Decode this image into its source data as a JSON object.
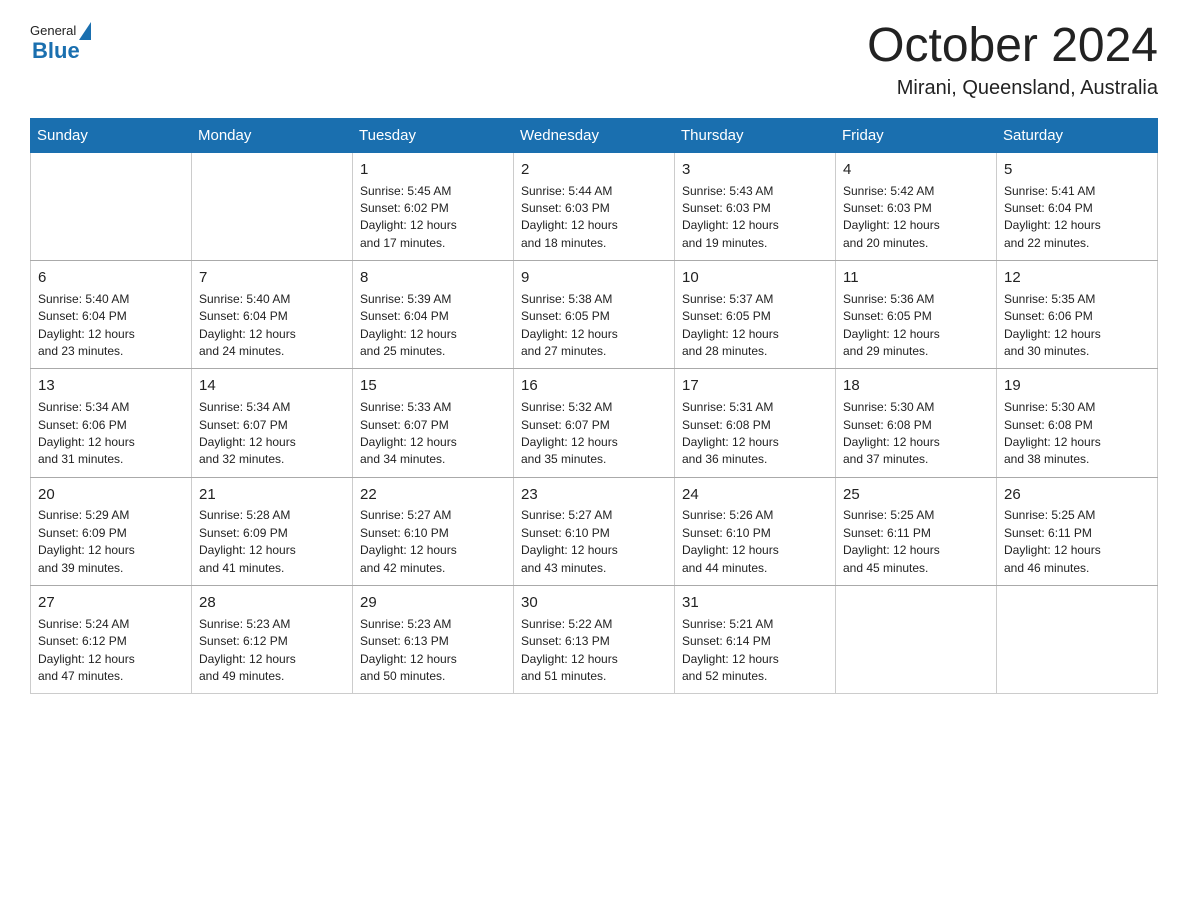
{
  "header": {
    "logo_general": "General",
    "logo_blue": "Blue",
    "main_title": "October 2024",
    "subtitle": "Mirani, Queensland, Australia"
  },
  "calendar": {
    "weekdays": [
      "Sunday",
      "Monday",
      "Tuesday",
      "Wednesday",
      "Thursday",
      "Friday",
      "Saturday"
    ],
    "rows": [
      [
        {
          "day": "",
          "info": ""
        },
        {
          "day": "",
          "info": ""
        },
        {
          "day": "1",
          "info": "Sunrise: 5:45 AM\nSunset: 6:02 PM\nDaylight: 12 hours\nand 17 minutes."
        },
        {
          "day": "2",
          "info": "Sunrise: 5:44 AM\nSunset: 6:03 PM\nDaylight: 12 hours\nand 18 minutes."
        },
        {
          "day": "3",
          "info": "Sunrise: 5:43 AM\nSunset: 6:03 PM\nDaylight: 12 hours\nand 19 minutes."
        },
        {
          "day": "4",
          "info": "Sunrise: 5:42 AM\nSunset: 6:03 PM\nDaylight: 12 hours\nand 20 minutes."
        },
        {
          "day": "5",
          "info": "Sunrise: 5:41 AM\nSunset: 6:04 PM\nDaylight: 12 hours\nand 22 minutes."
        }
      ],
      [
        {
          "day": "6",
          "info": "Sunrise: 5:40 AM\nSunset: 6:04 PM\nDaylight: 12 hours\nand 23 minutes."
        },
        {
          "day": "7",
          "info": "Sunrise: 5:40 AM\nSunset: 6:04 PM\nDaylight: 12 hours\nand 24 minutes."
        },
        {
          "day": "8",
          "info": "Sunrise: 5:39 AM\nSunset: 6:04 PM\nDaylight: 12 hours\nand 25 minutes."
        },
        {
          "day": "9",
          "info": "Sunrise: 5:38 AM\nSunset: 6:05 PM\nDaylight: 12 hours\nand 27 minutes."
        },
        {
          "day": "10",
          "info": "Sunrise: 5:37 AM\nSunset: 6:05 PM\nDaylight: 12 hours\nand 28 minutes."
        },
        {
          "day": "11",
          "info": "Sunrise: 5:36 AM\nSunset: 6:05 PM\nDaylight: 12 hours\nand 29 minutes."
        },
        {
          "day": "12",
          "info": "Sunrise: 5:35 AM\nSunset: 6:06 PM\nDaylight: 12 hours\nand 30 minutes."
        }
      ],
      [
        {
          "day": "13",
          "info": "Sunrise: 5:34 AM\nSunset: 6:06 PM\nDaylight: 12 hours\nand 31 minutes."
        },
        {
          "day": "14",
          "info": "Sunrise: 5:34 AM\nSunset: 6:07 PM\nDaylight: 12 hours\nand 32 minutes."
        },
        {
          "day": "15",
          "info": "Sunrise: 5:33 AM\nSunset: 6:07 PM\nDaylight: 12 hours\nand 34 minutes."
        },
        {
          "day": "16",
          "info": "Sunrise: 5:32 AM\nSunset: 6:07 PM\nDaylight: 12 hours\nand 35 minutes."
        },
        {
          "day": "17",
          "info": "Sunrise: 5:31 AM\nSunset: 6:08 PM\nDaylight: 12 hours\nand 36 minutes."
        },
        {
          "day": "18",
          "info": "Sunrise: 5:30 AM\nSunset: 6:08 PM\nDaylight: 12 hours\nand 37 minutes."
        },
        {
          "day": "19",
          "info": "Sunrise: 5:30 AM\nSunset: 6:08 PM\nDaylight: 12 hours\nand 38 minutes."
        }
      ],
      [
        {
          "day": "20",
          "info": "Sunrise: 5:29 AM\nSunset: 6:09 PM\nDaylight: 12 hours\nand 39 minutes."
        },
        {
          "day": "21",
          "info": "Sunrise: 5:28 AM\nSunset: 6:09 PM\nDaylight: 12 hours\nand 41 minutes."
        },
        {
          "day": "22",
          "info": "Sunrise: 5:27 AM\nSunset: 6:10 PM\nDaylight: 12 hours\nand 42 minutes."
        },
        {
          "day": "23",
          "info": "Sunrise: 5:27 AM\nSunset: 6:10 PM\nDaylight: 12 hours\nand 43 minutes."
        },
        {
          "day": "24",
          "info": "Sunrise: 5:26 AM\nSunset: 6:10 PM\nDaylight: 12 hours\nand 44 minutes."
        },
        {
          "day": "25",
          "info": "Sunrise: 5:25 AM\nSunset: 6:11 PM\nDaylight: 12 hours\nand 45 minutes."
        },
        {
          "day": "26",
          "info": "Sunrise: 5:25 AM\nSunset: 6:11 PM\nDaylight: 12 hours\nand 46 minutes."
        }
      ],
      [
        {
          "day": "27",
          "info": "Sunrise: 5:24 AM\nSunset: 6:12 PM\nDaylight: 12 hours\nand 47 minutes."
        },
        {
          "day": "28",
          "info": "Sunrise: 5:23 AM\nSunset: 6:12 PM\nDaylight: 12 hours\nand 49 minutes."
        },
        {
          "day": "29",
          "info": "Sunrise: 5:23 AM\nSunset: 6:13 PM\nDaylight: 12 hours\nand 50 minutes."
        },
        {
          "day": "30",
          "info": "Sunrise: 5:22 AM\nSunset: 6:13 PM\nDaylight: 12 hours\nand 51 minutes."
        },
        {
          "day": "31",
          "info": "Sunrise: 5:21 AM\nSunset: 6:14 PM\nDaylight: 12 hours\nand 52 minutes."
        },
        {
          "day": "",
          "info": ""
        },
        {
          "day": "",
          "info": ""
        }
      ]
    ]
  }
}
